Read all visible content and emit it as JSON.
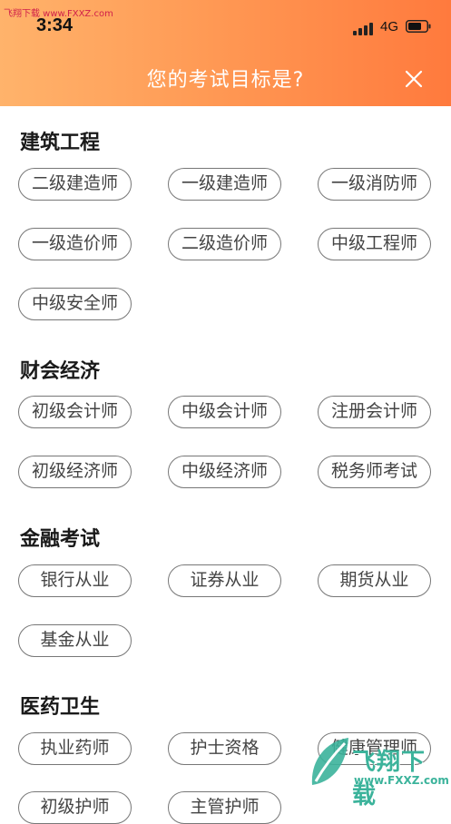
{
  "watermark_top": "飞翔下载 www.FXXZ.com",
  "status_bar": {
    "time": "3:34",
    "network": "4G"
  },
  "header": {
    "title": "您的考试目标是?"
  },
  "sections": [
    {
      "title": "建筑工程",
      "items": [
        "二级建造师",
        "一级建造师",
        "一级消防师",
        "一级造价师",
        "二级造价师",
        "中级工程师",
        "中级安全师"
      ]
    },
    {
      "title": "财会经济",
      "items": [
        "初级会计师",
        "中级会计师",
        "注册会计师",
        "初级经济师",
        "中级经济师",
        "税务师考试"
      ]
    },
    {
      "title": "金融考试",
      "items": [
        "银行从业",
        "证券从业",
        "期货从业",
        "基金从业"
      ]
    },
    {
      "title": "医药卫生",
      "items": [
        "执业药师",
        "护士资格",
        "健康管理师",
        "初级护师",
        "主管护师"
      ]
    }
  ],
  "watermark_logo": {
    "text": "飞翔下载",
    "url": "www.FXXZ.com"
  },
  "colors": {
    "header_start": "#ffb36b",
    "header_end": "#ff7a3d",
    "tag_border": "#777777",
    "logo": "#3bb39b"
  }
}
